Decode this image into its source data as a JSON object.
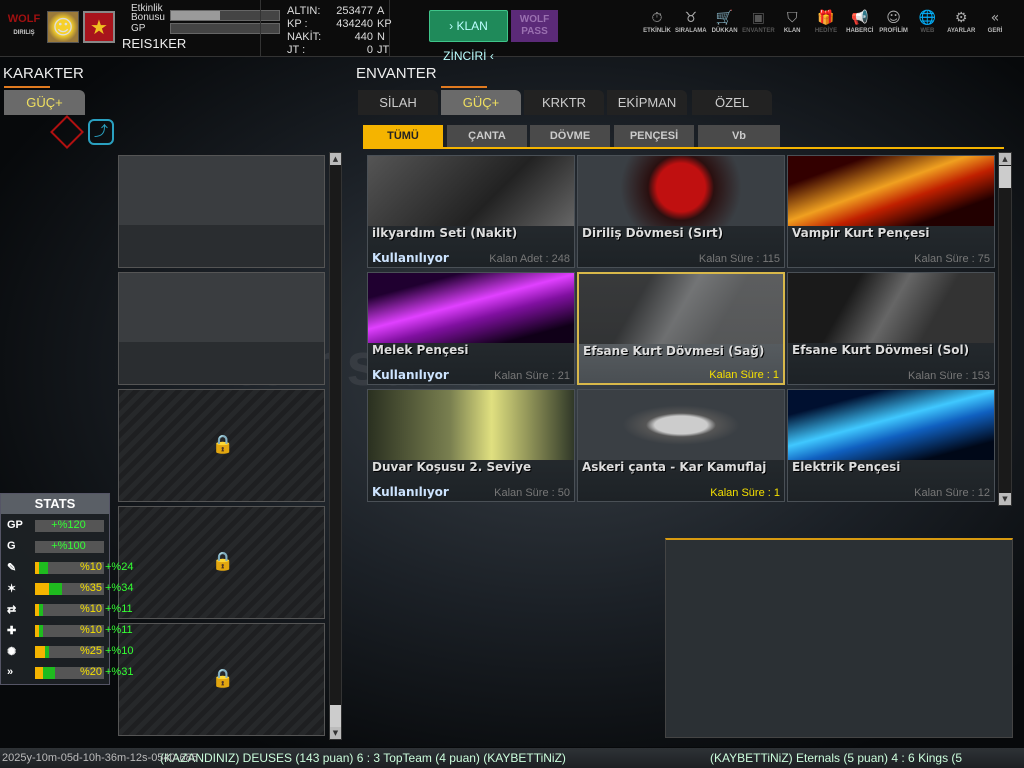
{
  "topbar": {
    "logo": "WOLF",
    "logo_sub": "DIRILIŞ",
    "event_bonus_label": "Etkinlik Bonusu",
    "event_bonus_fill": 0.45,
    "gp_label": "GP",
    "gp_fill": 0,
    "player_name": "REIS1KER",
    "currency": [
      {
        "label": "ALTIN:",
        "value": "253477",
        "unit": "A"
      },
      {
        "label": "KP :",
        "value": "434240",
        "unit": "KP"
      },
      {
        "label": "NAKİT:",
        "value": "440",
        "unit": "N"
      },
      {
        "label": "JT :",
        "value": "0",
        "unit": "JT"
      }
    ],
    "klan_button": "› KLAN ZİNCİRİ ‹",
    "wolf_pass": "WOLF PASS",
    "nav": [
      {
        "label": "ETKİNLİK",
        "icon": "⏱",
        "dim": false
      },
      {
        "label": "SIRALAMA",
        "icon": "♉",
        "dim": false
      },
      {
        "label": "DÜKKAN",
        "icon": "🛒",
        "dim": false
      },
      {
        "label": "ENVANTER",
        "icon": "▣",
        "dim": true
      },
      {
        "label": "KLAN",
        "icon": "⛉",
        "dim": false
      },
      {
        "label": "HEDİYE",
        "icon": "🎁",
        "dim": true
      },
      {
        "label": "HABERCİ",
        "icon": "📢",
        "dim": false
      },
      {
        "label": "PROFİLİM",
        "icon": "☺",
        "dim": false
      },
      {
        "label": "WEB",
        "icon": "🌐",
        "dim": true
      },
      {
        "label": "AYARLAR",
        "icon": "⚙",
        "dim": false
      },
      {
        "label": "GERİ",
        "icon": "«",
        "dim": false
      }
    ]
  },
  "karakter": {
    "title": "KARAKTER",
    "tab": "GÜÇ+"
  },
  "stats": {
    "title": "STATS",
    "rows": [
      {
        "icon": "GP",
        "value": "+%120",
        "bonus": "",
        "yellow": 0,
        "green": 0
      },
      {
        "icon": "G",
        "value": "+%100",
        "bonus": "",
        "yellow": 0,
        "green": 0
      },
      {
        "icon": "✎",
        "value": "%10",
        "bonus": "+%24",
        "yellow": 10,
        "green": 24
      },
      {
        "icon": "✶",
        "value": "%35",
        "bonus": "+%34",
        "yellow": 35,
        "green": 34
      },
      {
        "icon": "⇄",
        "value": "%10",
        "bonus": "+%11",
        "yellow": 10,
        "green": 11
      },
      {
        "icon": "✚",
        "value": "%10",
        "bonus": "+%11",
        "yellow": 10,
        "green": 11
      },
      {
        "icon": "✺",
        "value": "%25",
        "bonus": "+%10",
        "yellow": 25,
        "green": 10
      },
      {
        "icon": "»",
        "value": "%20",
        "bonus": "+%31",
        "yellow": 20,
        "green": 31
      }
    ]
  },
  "envanter": {
    "title": "ENVANTER",
    "tabs": [
      "SİLAH",
      "GÜÇ+",
      "KRKTR",
      "EKİPMAN",
      "ÖZEL"
    ],
    "active_tab": 1,
    "subtabs": [
      "TÜMÜ",
      "ÇANTA",
      "DÖVME",
      "PENÇESİ",
      "Vb"
    ],
    "active_subtab": 0,
    "items": [
      {
        "name": "ilkyardım Seti (Nakit)",
        "status": "Kullanılıyor",
        "remaining": "Kalan Adet : 248",
        "highlight": false,
        "selected": false,
        "art": "linear-gradient(135deg,#555,#222 60%,#666)"
      },
      {
        "name": "Diriliş Dövmesi (Sırt)",
        "status": "",
        "remaining": "Kalan Süre : 115",
        "highlight": false,
        "selected": false,
        "art": "radial-gradient(circle at 50% 45%,#c01010 0 22%,#2a1010 30%,#3a3f44 55%)"
      },
      {
        "name": "Vampir Kurt Pençesi",
        "status": "",
        "remaining": "Kalan Süre : 75",
        "highlight": false,
        "selected": false,
        "art": "linear-gradient(160deg,#300 20%,#f0a020 45%,#c02000 60%,#200 80%)"
      },
      {
        "name": "Melek Pençesi",
        "status": "Kullanılıyor",
        "remaining": "Kalan Süre : 21",
        "highlight": false,
        "selected": false,
        "art": "linear-gradient(165deg,#200030 20%,#e040ff 45%,#8010a0 60%,#100018 85%)"
      },
      {
        "name": "Efsane Kurt Dövmesi (Sağ)",
        "status": "",
        "remaining": "Kalan Süre : 1",
        "highlight": true,
        "selected": true,
        "art": "linear-gradient(120deg,#222 30%,#777 50%,#555 70%)"
      },
      {
        "name": "Efsane Kurt Dövmesi (Sol)",
        "status": "",
        "remaining": "Kalan Süre : 153",
        "highlight": false,
        "selected": false,
        "art": "linear-gradient(120deg,#1a1a1a 30%,#666 50%,#333 70%)"
      },
      {
        "name": "Duvar Koşusu 2. Seviye",
        "status": "Kullanılıyor",
        "remaining": "Kalan Süre : 50",
        "highlight": false,
        "selected": false,
        "art": "linear-gradient(90deg,#2a3020,#7a8050 40%,#e0e080 60%,#303828)"
      },
      {
        "name": "Askeri çanta - Kar Kamuflaj",
        "status": "",
        "remaining": "Kalan Süre : 1",
        "highlight": true,
        "selected": false,
        "art": "radial-gradient(ellipse at 50% 50%,#ccc 0 18%,#555 24%,#3a3f44 40%)"
      },
      {
        "name": "Elektrik Pençesi",
        "status": "",
        "remaining": "Kalan Süre : 12",
        "highlight": false,
        "selected": false,
        "art": "linear-gradient(165deg,#001030 20%,#40c8ff 45%,#1060c0 60%,#000818 85%)"
      }
    ]
  },
  "watermark": "itemsatis",
  "ticker": {
    "line1": "(KAZANDINIZ) DEUSES (143 puan) 6 : 3 TopTeam (4 puan) (KAYBETTiNiZ)",
    "line2": "(KAYBETTiNiZ) Eternals (5 puan) 4 : 6 Kings (5",
    "timestamp": "2025y-10m-05d-10h-36m-12s-0540-685"
  }
}
